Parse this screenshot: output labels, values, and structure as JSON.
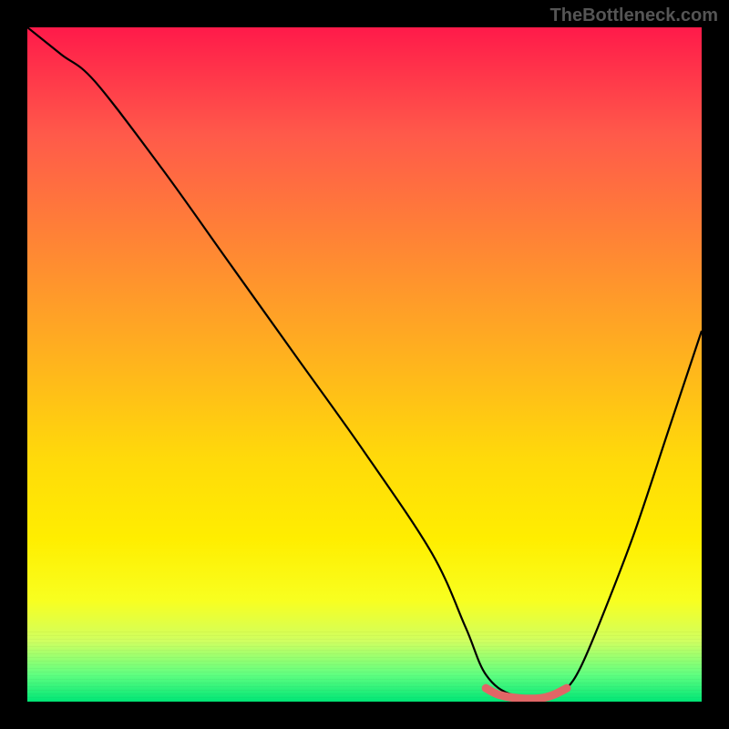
{
  "watermark": "TheBottleneck.com",
  "chart_data": {
    "type": "line",
    "title": "",
    "xlabel": "",
    "ylabel": "",
    "xlim": [
      0,
      100
    ],
    "ylim": [
      0,
      100
    ],
    "series": [
      {
        "name": "bottleneck-curve",
        "x": [
          0,
          5,
          10,
          20,
          30,
          40,
          50,
          60,
          65,
          68,
          72,
          78,
          80,
          82,
          85,
          90,
          95,
          100
        ],
        "values": [
          100,
          96,
          92,
          79,
          65,
          51,
          37,
          22,
          11,
          4,
          1,
          1,
          2,
          5,
          12,
          25,
          40,
          55
        ]
      },
      {
        "name": "optimal-zone",
        "x": [
          68,
          70,
          73,
          76,
          78,
          80
        ],
        "values": [
          2,
          1,
          0.5,
          0.5,
          1,
          2
        ]
      }
    ],
    "gradient_meaning": "red=high bottleneck, green=low bottleneck"
  }
}
